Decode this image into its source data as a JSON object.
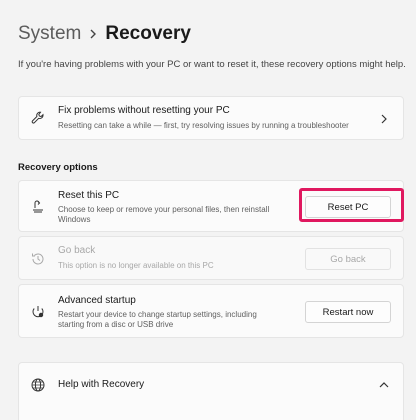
{
  "breadcrumb": {
    "parent": "System",
    "current": "Recovery"
  },
  "intro": "If you're having problems with your PC or want to reset it, these recovery options might help.",
  "fix_card": {
    "title": "Fix problems without resetting your PC",
    "subtitle": "Resetting can take a while — first, try resolving issues by running a troubleshooter"
  },
  "section_label": "Recovery options",
  "reset": {
    "title": "Reset this PC",
    "subtitle_line1": "Choose to keep or remove your personal files, then reinstall",
    "subtitle_line2": "Windows",
    "button": "Reset PC"
  },
  "goback": {
    "title": "Go back",
    "subtitle": "This option is no longer available on this PC",
    "button": "Go back"
  },
  "advanced": {
    "title": "Advanced startup",
    "subtitle_line1": "Restart your device to change startup settings, including",
    "subtitle_line2": "starting from a disc or USB drive",
    "button": "Restart now"
  },
  "help": {
    "title": "Help with Recovery"
  },
  "colors": {
    "highlight": "#e0185f",
    "background": "#f3f3f3",
    "card": "#fbfbfb"
  },
  "icons": {
    "fix": "wrench-icon",
    "reset": "reset-pc-icon",
    "goback": "history-icon",
    "advanced": "advanced-startup-icon",
    "help": "globe-icon"
  }
}
